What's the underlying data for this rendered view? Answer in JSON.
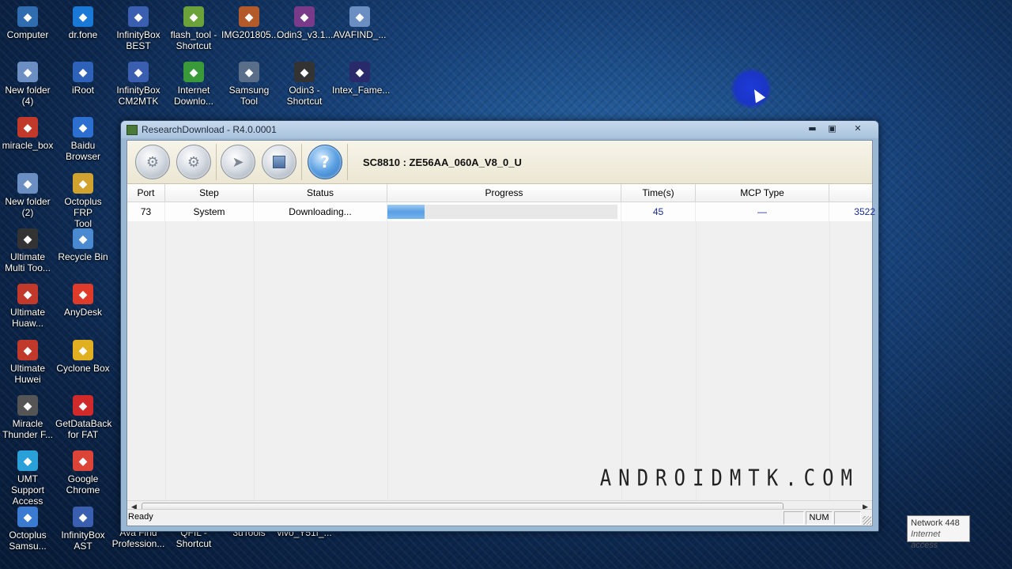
{
  "desktop": {
    "icons": [
      {
        "label": "Computer",
        "icon": "computer-icon",
        "color": "#2f6db0"
      },
      {
        "label": "dr.fone",
        "icon": "drfone-icon",
        "color": "#1a78d6"
      },
      {
        "label": "InfinityBox\nBEST",
        "icon": "infinitybox-icon",
        "color": "#3a5fb0"
      },
      {
        "label": "flash_tool -\nShortcut",
        "icon": "android-icon",
        "color": "#6ba33a"
      },
      {
        "label": "IMG201805...",
        "icon": "image-icon",
        "color": "#b35a2a"
      },
      {
        "label": "Odin3_v3.1...",
        "icon": "winrar-icon",
        "color": "#7a3a8a"
      },
      {
        "label": "AVAFIND_...",
        "icon": "folder-icon",
        "color": "#6b8fc2"
      },
      {
        "label": "New folder\n(4)",
        "icon": "folder-icon",
        "color": "#6b8fc2"
      },
      {
        "label": "iRoot",
        "icon": "anchor-icon",
        "color": "#2d62b8"
      },
      {
        "label": "InfinityBox\nCM2MTK",
        "icon": "infinitybox-icon",
        "color": "#3a5fb0"
      },
      {
        "label": "Internet\nDownlo...",
        "icon": "idm-icon",
        "color": "#3a9a3a"
      },
      {
        "label": "Samsung\nTool",
        "icon": "gear-icon",
        "color": "#5a6e8a"
      },
      {
        "label": "Odin3 -\nShortcut",
        "icon": "odin-icon",
        "color": "#333333"
      },
      {
        "label": "Intex_Fame...",
        "icon": "intex-icon",
        "color": "#2a2a6a"
      },
      {
        "label": "miracle_box",
        "icon": "miracle-icon",
        "color": "#c0392b"
      },
      {
        "label": "Baidu\nBrowser",
        "icon": "baidu-icon",
        "color": "#2d6fd1"
      },
      {
        "label": "New folder\n(2)",
        "icon": "folder-icon",
        "color": "#6b8fc2"
      },
      {
        "label": "Octoplus FRP\nTool",
        "icon": "octoplus-icon",
        "color": "#d1a22d"
      },
      {
        "label": "Ultimate\nMulti Too...",
        "icon": "ultimate-icon",
        "color": "#333333"
      },
      {
        "label": "Recycle Bin",
        "icon": "recycle-bin-icon",
        "color": "#4a8ad0"
      },
      {
        "label": "Ultimate\nHuaw...",
        "icon": "huawei-icon",
        "color": "#c0392b"
      },
      {
        "label": "AnyDesk",
        "icon": "anydesk-icon",
        "color": "#e03a2a"
      },
      {
        "label": "Ultimate\nHuwei",
        "icon": "huawei-icon",
        "color": "#c0392b"
      },
      {
        "label": "Cyclone Box",
        "icon": "cyclone-icon",
        "color": "#e0b020"
      },
      {
        "label": "Miracle\nThunder F...",
        "icon": "thunder-icon",
        "color": "#555555"
      },
      {
        "label": "GetDataBack\nfor FAT",
        "icon": "lifebuoy-icon",
        "color": "#d02a2a"
      },
      {
        "label": "UMT Support\nAccess",
        "icon": "umt-icon",
        "color": "#2aa0d8"
      },
      {
        "label": "Google\nChrome",
        "icon": "chrome-icon",
        "color": "#db4437"
      },
      {
        "label": "Octoplus\nSamsu...",
        "icon": "octoplus-icon",
        "color": "#3a7ad0"
      },
      {
        "label": "InfinityBox\nAST",
        "icon": "infinitybox-icon",
        "color": "#3a5fb0"
      }
    ],
    "partial_labels": [
      "Ava Find\nProfession...",
      "QFIL -\nShortcut",
      "3uTools",
      "vivo_Y51f_..."
    ]
  },
  "window": {
    "title": "ResearchDownload - R4.0.0001",
    "buttons": {
      "minimize": "▬",
      "maximize": "▣",
      "close": "✕"
    }
  },
  "toolbar": {
    "chip_label": "SC8810 :  ZE56AA_060A_V8_0_U",
    "buttons": [
      {
        "name": "load-packet",
        "icon": "gear-icon"
      },
      {
        "name": "settings",
        "icon": "settings-icon"
      },
      {
        "name": "start",
        "icon": "play-icon"
      },
      {
        "name": "stop",
        "icon": "stop-icon"
      },
      {
        "name": "help",
        "icon": "help-icon",
        "glyph": "?"
      }
    ]
  },
  "grid": {
    "columns": [
      "Port",
      "Step",
      "Status",
      "Progress",
      "Time(s)",
      "MCP Type",
      ""
    ],
    "rows": [
      {
        "port": "73",
        "step": "System",
        "status": "Downloading...",
        "progress": 0.16,
        "time": "45",
        "mcp_type": "—",
        "extra": "3522"
      }
    ]
  },
  "watermark": "ANDROIDMTK.COM",
  "statusbar": {
    "text": "Ready",
    "num": "NUM"
  },
  "network_tooltip": {
    "line1": "Network  448",
    "line2": "Internet access"
  },
  "colors": {
    "time_text": "#1a2d9c",
    "progress_fill": "#5a9fe3"
  }
}
